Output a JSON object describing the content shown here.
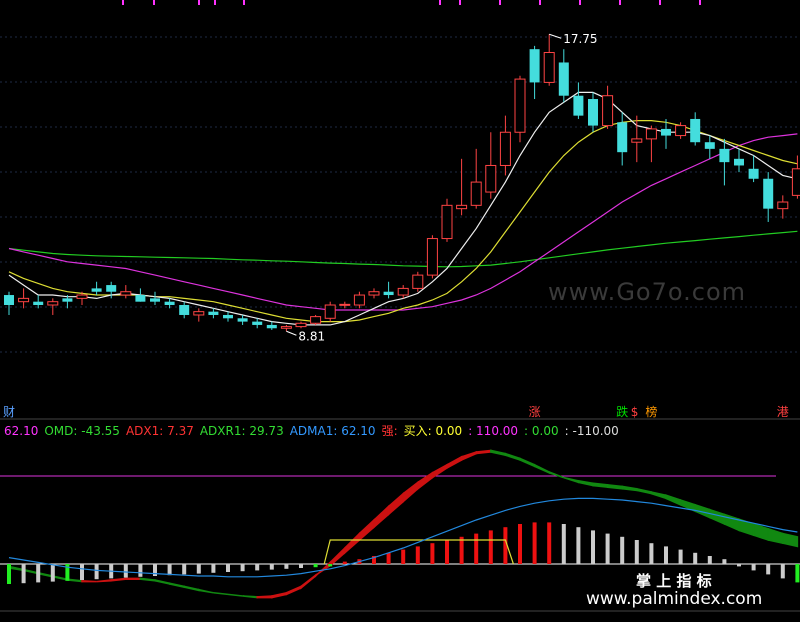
{
  "chart_data": {
    "type": "candlestick",
    "price_pane": {
      "high_label": "17.75",
      "low_label": "8.81",
      "ylim": [
        6.5,
        18.6
      ],
      "candles": [
        {
          "o": 9.6,
          "h": 10.0,
          "l": 9.3,
          "c": 9.9,
          "up": false
        },
        {
          "o": 9.8,
          "h": 10.1,
          "l": 9.5,
          "c": 9.7,
          "up": true
        },
        {
          "o": 9.7,
          "h": 9.9,
          "l": 9.5,
          "c": 9.6,
          "up": false
        },
        {
          "o": 9.6,
          "h": 9.8,
          "l": 9.3,
          "c": 9.7,
          "up": true
        },
        {
          "o": 9.7,
          "h": 9.9,
          "l": 9.5,
          "c": 9.8,
          "up": false
        },
        {
          "o": 9.8,
          "h": 10.0,
          "l": 9.6,
          "c": 9.9,
          "up": true
        },
        {
          "o": 10.1,
          "h": 10.3,
          "l": 9.9,
          "c": 10.0,
          "up": false
        },
        {
          "o": 10.0,
          "h": 10.3,
          "l": 9.8,
          "c": 10.2,
          "up": false
        },
        {
          "o": 10.0,
          "h": 10.2,
          "l": 9.8,
          "c": 9.9,
          "up": true
        },
        {
          "o": 9.9,
          "h": 10.1,
          "l": 9.7,
          "c": 9.7,
          "up": false
        },
        {
          "o": 9.8,
          "h": 10.0,
          "l": 9.6,
          "c": 9.7,
          "up": false
        },
        {
          "o": 9.7,
          "h": 9.8,
          "l": 9.5,
          "c": 9.6,
          "up": false
        },
        {
          "o": 9.6,
          "h": 9.7,
          "l": 9.2,
          "c": 9.3,
          "up": false
        },
        {
          "o": 9.3,
          "h": 9.5,
          "l": 9.1,
          "c": 9.4,
          "up": true
        },
        {
          "o": 9.4,
          "h": 9.5,
          "l": 9.2,
          "c": 9.3,
          "up": false
        },
        {
          "o": 9.3,
          "h": 9.4,
          "l": 9.1,
          "c": 9.2,
          "up": false
        },
        {
          "o": 9.2,
          "h": 9.3,
          "l": 9.0,
          "c": 9.1,
          "up": false
        },
        {
          "o": 9.1,
          "h": 9.2,
          "l": 8.9,
          "c": 9.0,
          "up": false
        },
        {
          "o": 9.0,
          "h": 9.1,
          "l": 8.85,
          "c": 8.9,
          "up": false
        },
        {
          "o": 8.9,
          "h": 9.0,
          "l": 8.81,
          "c": 8.95,
          "up": true
        },
        {
          "o": 8.95,
          "h": 9.1,
          "l": 8.9,
          "c": 9.05,
          "up": true
        },
        {
          "o": 9.05,
          "h": 9.3,
          "l": 9.0,
          "c": 9.25,
          "up": true
        },
        {
          "o": 9.2,
          "h": 9.7,
          "l": 9.1,
          "c": 9.6,
          "up": true
        },
        {
          "o": 9.6,
          "h": 9.7,
          "l": 9.5,
          "c": 9.62,
          "up": true
        },
        {
          "o": 9.6,
          "h": 10.0,
          "l": 9.5,
          "c": 9.9,
          "up": true
        },
        {
          "o": 9.9,
          "h": 10.1,
          "l": 9.8,
          "c": 10.0,
          "up": true
        },
        {
          "o": 10.0,
          "h": 10.3,
          "l": 9.8,
          "c": 9.9,
          "up": false
        },
        {
          "o": 9.9,
          "h": 10.2,
          "l": 9.8,
          "c": 10.1,
          "up": true
        },
        {
          "o": 10.1,
          "h": 10.6,
          "l": 10.0,
          "c": 10.5,
          "up": true
        },
        {
          "o": 10.5,
          "h": 11.7,
          "l": 10.4,
          "c": 11.6,
          "up": true
        },
        {
          "o": 11.6,
          "h": 12.8,
          "l": 11.5,
          "c": 12.6,
          "up": true
        },
        {
          "o": 12.5,
          "h": 14.0,
          "l": 12.3,
          "c": 12.6,
          "up": true
        },
        {
          "o": 12.6,
          "h": 14.3,
          "l": 12.5,
          "c": 13.3,
          "up": true
        },
        {
          "o": 13.0,
          "h": 14.8,
          "l": 12.8,
          "c": 13.8,
          "up": true
        },
        {
          "o": 13.8,
          "h": 15.3,
          "l": 13.5,
          "c": 14.8,
          "up": true
        },
        {
          "o": 14.8,
          "h": 16.5,
          "l": 14.5,
          "c": 16.4,
          "up": true
        },
        {
          "o": 17.3,
          "h": 17.4,
          "l": 15.8,
          "c": 16.3,
          "up": false
        },
        {
          "o": 16.3,
          "h": 17.75,
          "l": 16.2,
          "c": 17.2,
          "up": true
        },
        {
          "o": 16.9,
          "h": 17.3,
          "l": 15.7,
          "c": 15.9,
          "up": false
        },
        {
          "o": 15.9,
          "h": 16.3,
          "l": 15.2,
          "c": 15.3,
          "up": false
        },
        {
          "o": 15.8,
          "h": 16.0,
          "l": 14.8,
          "c": 15.0,
          "up": false
        },
        {
          "o": 15.0,
          "h": 16.2,
          "l": 14.9,
          "c": 15.9,
          "up": true
        },
        {
          "o": 15.1,
          "h": 15.4,
          "l": 13.8,
          "c": 14.2,
          "up": false
        },
        {
          "o": 14.5,
          "h": 15.3,
          "l": 13.9,
          "c": 14.6,
          "up": true
        },
        {
          "o": 14.6,
          "h": 15.0,
          "l": 13.9,
          "c": 14.9,
          "up": true
        },
        {
          "o": 14.9,
          "h": 15.2,
          "l": 14.3,
          "c": 14.7,
          "up": false
        },
        {
          "o": 14.7,
          "h": 15.1,
          "l": 14.6,
          "c": 15.0,
          "up": true
        },
        {
          "o": 15.2,
          "h": 15.4,
          "l": 14.4,
          "c": 14.5,
          "up": false
        },
        {
          "o": 14.5,
          "h": 14.7,
          "l": 14.0,
          "c": 14.3,
          "up": false
        },
        {
          "o": 14.3,
          "h": 14.6,
          "l": 13.2,
          "c": 13.9,
          "up": false
        },
        {
          "o": 14.0,
          "h": 14.3,
          "l": 13.6,
          "c": 13.8,
          "up": false
        },
        {
          "o": 13.7,
          "h": 14.1,
          "l": 13.3,
          "c": 13.4,
          "up": false
        },
        {
          "o": 13.4,
          "h": 13.6,
          "l": 12.1,
          "c": 12.5,
          "up": false
        },
        {
          "o": 12.5,
          "h": 12.9,
          "l": 12.2,
          "c": 12.7,
          "up": true
        },
        {
          "o": 12.9,
          "h": 14.1,
          "l": 12.8,
          "c": 13.7,
          "up": true
        }
      ],
      "ma_short": [
        10.5,
        10.2,
        9.9,
        9.9,
        9.85,
        9.85,
        9.8,
        9.9,
        9.95,
        9.9,
        9.85,
        9.8,
        9.7,
        9.6,
        9.5,
        9.4,
        9.3,
        9.2,
        9.1,
        9.05,
        9.0,
        9.0,
        9.0,
        9.1,
        9.3,
        9.5,
        9.7,
        9.8,
        9.95,
        10.3,
        10.7,
        11.3,
        11.9,
        12.6,
        13.3,
        14.1,
        14.8,
        15.4,
        15.7,
        16.0,
        16.0,
        15.8,
        15.4,
        15.0,
        14.9,
        14.8,
        14.8,
        14.8,
        14.7,
        14.5,
        14.3,
        14.1,
        13.8,
        13.5,
        13.4
      ],
      "ma_mid": [
        10.6,
        10.4,
        10.25,
        10.1,
        10.0,
        9.95,
        9.9,
        9.9,
        9.9,
        9.9,
        9.85,
        9.85,
        9.8,
        9.75,
        9.7,
        9.6,
        9.5,
        9.4,
        9.3,
        9.2,
        9.15,
        9.1,
        9.1,
        9.1,
        9.15,
        9.25,
        9.35,
        9.5,
        9.6,
        9.75,
        9.95,
        10.3,
        10.7,
        11.2,
        11.8,
        12.4,
        13.0,
        13.6,
        14.1,
        14.5,
        14.8,
        15.0,
        15.1,
        15.15,
        15.15,
        15.1,
        15.0,
        14.85,
        14.7,
        14.55,
        14.4,
        14.25,
        14.1,
        13.95,
        13.85
      ],
      "ma_long": [
        11.3,
        11.2,
        11.1,
        11.0,
        10.9,
        10.85,
        10.8,
        10.75,
        10.7,
        10.6,
        10.5,
        10.4,
        10.3,
        10.2,
        10.1,
        10.0,
        9.9,
        9.8,
        9.7,
        9.6,
        9.55,
        9.5,
        9.45,
        9.45,
        9.45,
        9.45,
        9.45,
        9.45,
        9.5,
        9.55,
        9.65,
        9.75,
        9.9,
        10.1,
        10.35,
        10.6,
        10.9,
        11.2,
        11.5,
        11.8,
        12.1,
        12.4,
        12.7,
        12.95,
        13.2,
        13.4,
        13.6,
        13.8,
        14.0,
        14.2,
        14.4,
        14.55,
        14.65,
        14.7,
        14.75
      ],
      "ma_very_long": [
        11.3,
        11.25,
        11.2,
        11.15,
        11.12,
        11.1,
        11.08,
        11.07,
        11.06,
        11.05,
        11.04,
        11.03,
        11.02,
        11.01,
        11.0,
        10.98,
        10.96,
        10.95,
        10.93,
        10.92,
        10.9,
        10.88,
        10.86,
        10.85,
        10.83,
        10.82,
        10.8,
        10.78,
        10.77,
        10.76,
        10.75,
        10.76,
        10.78,
        10.8,
        10.85,
        10.9,
        10.96,
        11.02,
        11.08,
        11.14,
        11.2,
        11.26,
        11.31,
        11.36,
        11.41,
        11.46,
        11.5,
        11.54,
        11.58,
        11.62,
        11.66,
        11.7,
        11.74,
        11.78,
        11.82
      ],
      "event_markers": [
        {
          "index": 0,
          "label": "财",
          "color": "#5aa0ff"
        },
        {
          "index": 36,
          "label": "涨",
          "color": "#ff4040"
        },
        {
          "index": 42,
          "label": "跌",
          "color": "#00dd00"
        },
        {
          "index": 43,
          "label": "$",
          "color": "#ff4040"
        },
        {
          "index": 44,
          "label": "榜",
          "color": "#ff9900"
        },
        {
          "index": 53,
          "label": "港",
          "color": "#ff4040"
        }
      ]
    },
    "indicator_pane": {
      "labels": [
        {
          "text": "62.10",
          "color": "#ff33ff"
        },
        {
          "text": "OMD: -43.55",
          "color": "#33dd33"
        },
        {
          "text": "ADX1: 7.37",
          "color": "#ff3333"
        },
        {
          "text": "ADXR1: 29.73",
          "color": "#33dd33"
        },
        {
          "text": "ADMA1: 62.10",
          "color": "#3399ff"
        },
        {
          "text": "强:",
          "color": "#ff3333"
        },
        {
          "text": "买入: 0.00",
          "color": "#ffff33"
        },
        {
          "text": ": 110.00",
          "color": "#ff33ff"
        },
        {
          "text": ": 0.00",
          "color": "#33dd33"
        },
        {
          "text": ": -110.00",
          "color": "#dddddd"
        }
      ],
      "ylim": [
        -45,
        155
      ],
      "magenta_level": 110,
      "histogram": [
        -25,
        -24,
        -23,
        -22,
        -21,
        -20,
        -19,
        -18,
        -17,
        -16,
        -15,
        -14,
        -13,
        -12,
        -11,
        -10,
        -9,
        -8,
        -7,
        -6,
        -5,
        -4,
        -3,
        3,
        6,
        10,
        14,
        18,
        22,
        26,
        30,
        34,
        38,
        42,
        46,
        50,
        52,
        52,
        50,
        46,
        42,
        38,
        34,
        30,
        26,
        22,
        18,
        14,
        10,
        6,
        -3,
        -8,
        -13,
        -18,
        -23
      ],
      "histogram_color": [
        "green",
        "gray",
        "gray",
        "gray",
        "green",
        "gray",
        "gray",
        "gray",
        "gray",
        "gray",
        "gray",
        "gray",
        "gray",
        "gray",
        "gray",
        "gray",
        "gray",
        "gray",
        "gray",
        "gray",
        "gray",
        "green",
        "green",
        "red",
        "red",
        "red",
        "red",
        "red",
        "red",
        "red",
        "red",
        "red",
        "red",
        "red",
        "red",
        "red",
        "red",
        "red",
        "gray",
        "gray",
        "gray",
        "gray",
        "gray",
        "gray",
        "gray",
        "gray",
        "gray",
        "gray",
        "gray",
        "gray",
        "gray",
        "gray",
        "gray",
        "gray",
        "green"
      ],
      "line_a": [
        -5,
        -8,
        -12,
        -16,
        -20,
        -22,
        -22,
        -20,
        -18,
        -18,
        -20,
        -24,
        -28,
        -32,
        -36,
        -38,
        -40,
        -42,
        -42,
        -38,
        -30,
        -15,
        2,
        20,
        38,
        55,
        72,
        88,
        102,
        114,
        124,
        134,
        140,
        142,
        138,
        132,
        124,
        115,
        108,
        102,
        98,
        96,
        94,
        92,
        88,
        82,
        74,
        66,
        58,
        50,
        42,
        36,
        30,
        26,
        22
      ],
      "line_b": [
        -3,
        -7,
        -11,
        -15,
        -19,
        -21,
        -22,
        -21,
        -19,
        -19,
        -21,
        -25,
        -29,
        -33,
        -36,
        -38,
        -40,
        -41,
        -40,
        -36,
        -28,
        -14,
        -2,
        14,
        30,
        46,
        62,
        78,
        94,
        108,
        120,
        130,
        138,
        140,
        136,
        130,
        122,
        114,
        108,
        104,
        101,
        99,
        97,
        94,
        90,
        86,
        80,
        74,
        68,
        62,
        56,
        50,
        44,
        38,
        34
      ],
      "line_blue": [
        8,
        5,
        2,
        -1,
        -4,
        -6,
        -8,
        -9,
        -10,
        -11,
        -12,
        -13,
        -14,
        -15,
        -15,
        -16,
        -16,
        -16,
        -15,
        -14,
        -12,
        -9,
        -6,
        -2,
        3,
        8,
        14,
        20,
        27,
        34,
        41,
        48,
        55,
        61,
        67,
        72,
        76,
        79,
        81,
        82,
        82,
        81,
        80,
        78,
        76,
        73,
        70,
        67,
        63,
        59,
        55,
        51,
        47,
        43,
        40
      ],
      "step_line_start": 22,
      "step_line_end": 34,
      "step_line_level": 30
    }
  },
  "watermarks": {
    "top_right": "www.Go7o.com",
    "bottom_label": "掌 上 指 标",
    "bottom_url": "www.palmindex.com"
  }
}
